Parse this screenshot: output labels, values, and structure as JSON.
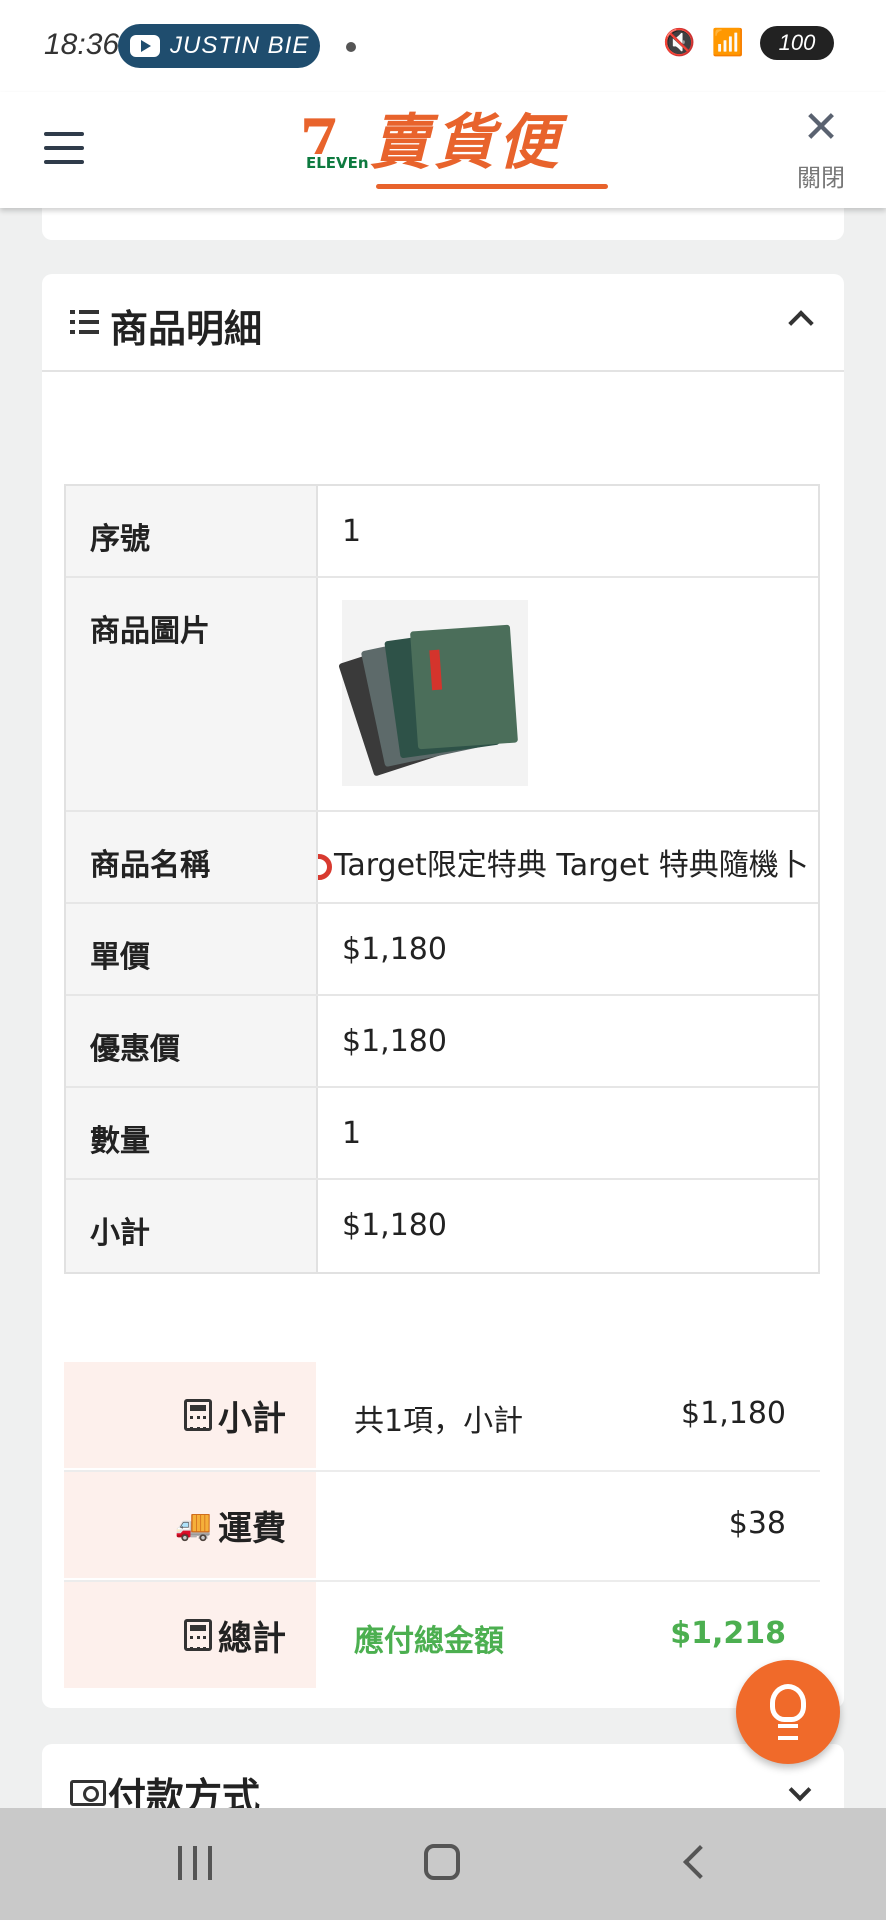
{
  "status_bar": {
    "time": "18:36",
    "media_label": "JUSTIN BIE",
    "battery": "100",
    "icons": [
      "mute-icon",
      "wifi-icon",
      "signal-icon"
    ]
  },
  "header": {
    "logo_brand": "7",
    "logo_eleven": "ELEVEn",
    "logo_text": "賣貨便",
    "close_label": "關閉"
  },
  "product_section": {
    "title": "商品明細",
    "rows": {
      "seq": {
        "label": "序號",
        "value": "1"
      },
      "image": {
        "label": "商品圖片"
      },
      "name": {
        "label": "商品名稱",
        "value": "Target限定特典 Target 特典隨機卜"
      },
      "unit_price": {
        "label": "單價",
        "value": "$1,180"
      },
      "discount_price": {
        "label": "優惠價",
        "value": "$1,180"
      },
      "quantity": {
        "label": "數量",
        "value": "1"
      },
      "line_subtotal": {
        "label": "小計",
        "value": "$1,180"
      }
    }
  },
  "summary": {
    "subtotal": {
      "label": "小計",
      "desc": "共1項，小計",
      "amount": "$1,180"
    },
    "shipping": {
      "label": "運費",
      "desc": "",
      "amount": "$38"
    },
    "total": {
      "label": "總計",
      "desc": "應付總金額",
      "amount": "$1,218"
    }
  },
  "payment_section": {
    "title": "付款方式"
  },
  "colors": {
    "brand_orange": "#e8632c",
    "total_green": "#4caf50",
    "summary_label_bg": "#fdf0ec"
  }
}
